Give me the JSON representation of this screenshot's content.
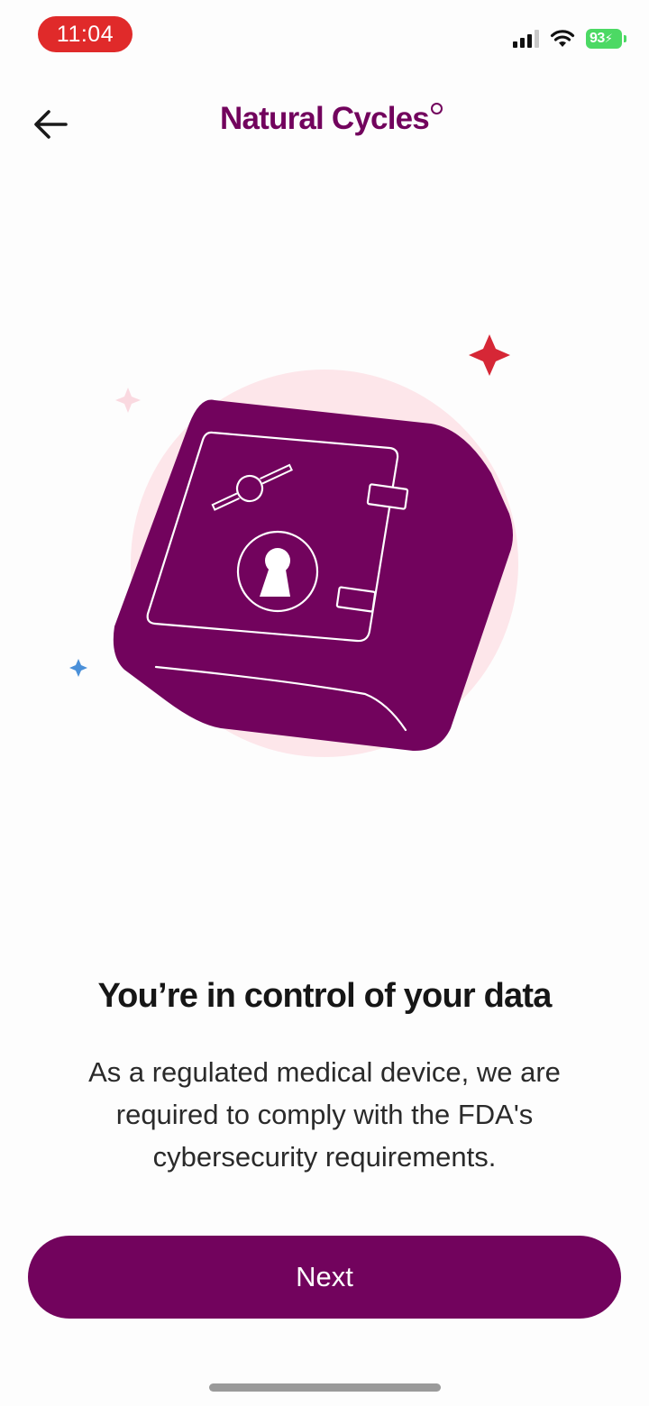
{
  "status_bar": {
    "time": "11:04",
    "battery": "93",
    "signal_icon": "cellular-signal-icon",
    "wifi_icon": "wifi-icon",
    "battery_icon": "battery-charging-icon"
  },
  "header": {
    "back_icon": "arrow-left-icon",
    "logo_text": "Natural Cycles"
  },
  "illustration": {
    "icon": "safe-vault-icon",
    "colors": {
      "safe": "#72035D",
      "background_blob": "#FDE6EA",
      "sparkle_red": "#D62736",
      "sparkle_pink": "#FAD9E0",
      "sparkle_blue": "#4A90D9"
    }
  },
  "content": {
    "headline": "You’re in control of your data",
    "body": "As a regulated medical device, we are required to comply with the FDA's cybersecurity requirements."
  },
  "actions": {
    "next_label": "Next"
  },
  "colors": {
    "brand": "#72035D",
    "status_pill": "#E02A2A",
    "battery": "#4CD964"
  }
}
